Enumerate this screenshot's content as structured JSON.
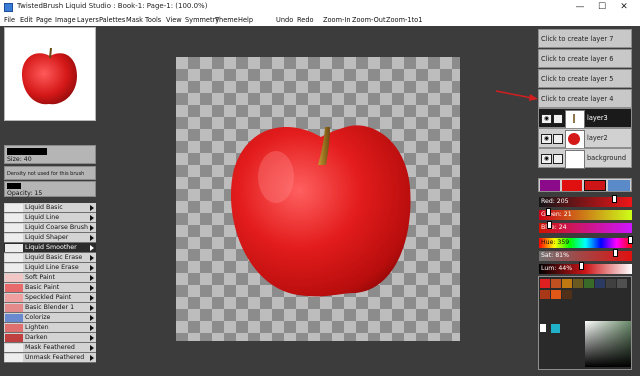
{
  "window": {
    "title": "TwistedBrush Liquid Studio : Book-1: Page-1: (100.0%)",
    "minimize_label": "—",
    "maximize_label": "☐",
    "close_label": "✕"
  },
  "menu": [
    "File",
    "Edit",
    "Page",
    "Image",
    "Layers",
    "Palettes",
    "Mask",
    "Tools",
    "View",
    "Symmetry",
    "Theme",
    "Help",
    "Undo",
    "Redo",
    "Zoom-In",
    "Zoom-Out",
    "Zoom-1to1"
  ],
  "brush_panel": {
    "size_label": "Size: 40",
    "density_label": "Density not used for this brush",
    "opacity_label": "Opacity: 15",
    "brushes": [
      {
        "label": "Liquid Basic",
        "selected": false
      },
      {
        "label": "Liquid Line",
        "selected": false
      },
      {
        "label": "Liquid Coarse Brush",
        "selected": false
      },
      {
        "label": "Liquid Shaper",
        "selected": false
      },
      {
        "label": "Liquid Smoother",
        "selected": true
      },
      {
        "label": "Liquid Basic Erase",
        "selected": false
      },
      {
        "label": "Liquid Line Erase",
        "selected": false
      },
      {
        "label": "Soft Paint",
        "selected": false
      },
      {
        "label": "Basic Paint",
        "selected": false
      },
      {
        "label": "Speckled Paint",
        "selected": false
      },
      {
        "label": "Basic Blender 1",
        "selected": false
      },
      {
        "label": "Colorize",
        "selected": false
      },
      {
        "label": "Lighten",
        "selected": false
      },
      {
        "label": "Darken",
        "selected": false
      },
      {
        "label": "Mask Feathered",
        "selected": false
      },
      {
        "label": "Unmask Feathered",
        "selected": false
      }
    ]
  },
  "layers": {
    "empty_slots": [
      "Click to create layer 7",
      "Click to create layer 6",
      "Click to create layer 5",
      "Click to create layer 4"
    ],
    "rows": [
      {
        "name": "layer3",
        "selected": true
      },
      {
        "name": "layer2",
        "selected": false
      },
      {
        "name": "background",
        "selected": false
      }
    ]
  },
  "color_panel": {
    "red_label": "Red: 205",
    "green_label": "Green: 21",
    "blue_label": "Blue: 24",
    "hue_label": "Hue: 359",
    "sat_label": "Sat: 81%",
    "lum_label": "Lum: 44%",
    "red": 205,
    "green": 21,
    "blue": 24,
    "hue": 359,
    "sat": 81,
    "lum": 44,
    "current_color": "#cd1518",
    "palette_colors": [
      "#cd1518",
      "#d9381a",
      "#c05a10",
      "#c97a10",
      "#7a5a20",
      "#3c6a20",
      "#2a4a7a",
      "#604020",
      "#a53010",
      "#e05010",
      "#402010",
      "#203040"
    ]
  },
  "icons": {
    "eye": "eye-icon",
    "lock": "lock-icon"
  }
}
